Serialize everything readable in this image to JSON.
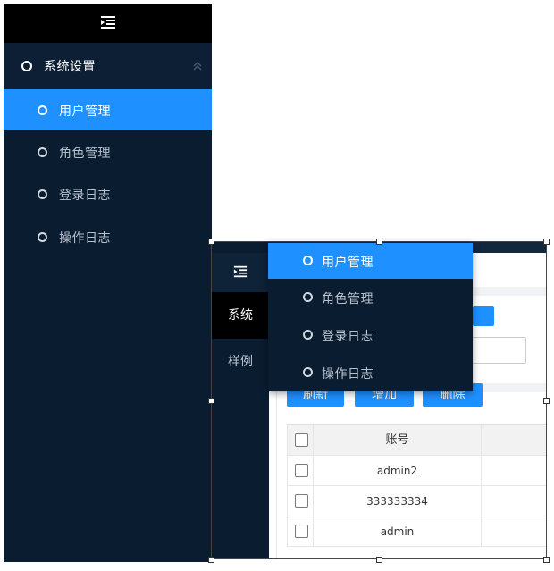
{
  "sidebar": {
    "section_title": "系统设置",
    "items": [
      {
        "label": "用户管理",
        "active": true
      },
      {
        "label": "角色管理",
        "active": false
      },
      {
        "label": "登录日志",
        "active": false
      },
      {
        "label": "操作日志",
        "active": false
      }
    ]
  },
  "collapsed_sidebar": {
    "items": [
      {
        "label": "系统",
        "active": true
      },
      {
        "label": "样例",
        "active": false
      }
    ]
  },
  "flyout": {
    "items": [
      {
        "label": "用户管理",
        "active": true
      },
      {
        "label": "角色管理",
        "active": false
      },
      {
        "label": "登录日志",
        "active": false
      },
      {
        "label": "操作日志",
        "active": false
      }
    ]
  },
  "toolbar": {
    "refresh_label": "刷新",
    "add_label": "增加",
    "delete_label": "删除"
  },
  "table": {
    "header": {
      "account": "账号"
    },
    "rows": [
      {
        "account": "admin2"
      },
      {
        "account": "333333334"
      },
      {
        "account": "admin"
      }
    ]
  },
  "colors": {
    "sidebar_bg": "#0a1c30",
    "active_accent": "#1e90ff",
    "top_bar": "#000000"
  },
  "icons": {
    "collapse": "indent-icon",
    "menu_item": "circle-icon",
    "expand": "chevron-up-icon"
  }
}
